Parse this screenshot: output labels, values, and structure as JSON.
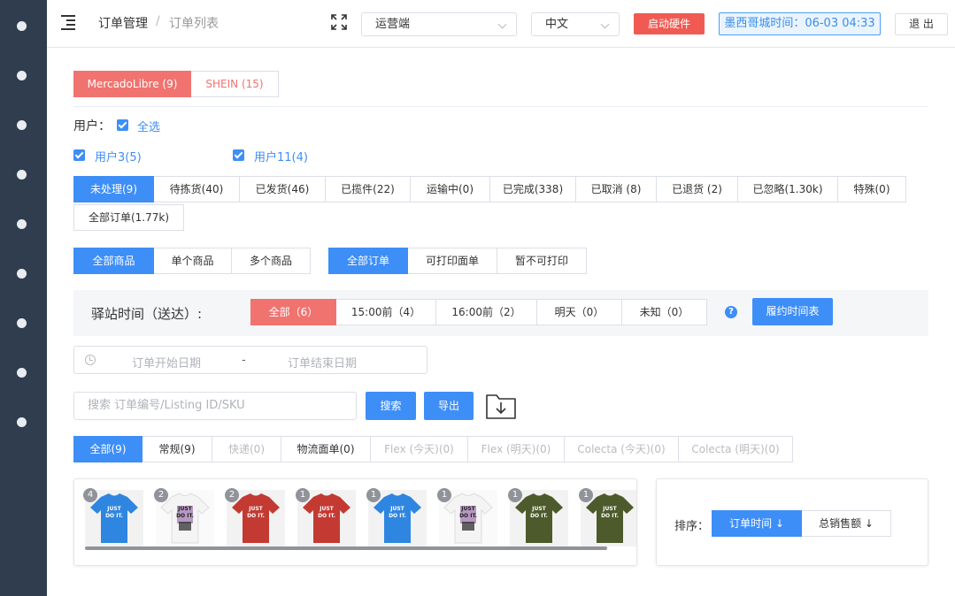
{
  "header": {
    "breadcrumb": [
      "订单管理",
      "订单列表"
    ],
    "breadcrumb_sep": "/",
    "platform_select": "运营端",
    "language_select": "中文",
    "start_hardware_label": "启动硬件",
    "time_label": "墨西哥城时间：06-03 04:33",
    "logout_label": "退 出"
  },
  "store_tabs": [
    {
      "label": "MercadoLibre (9)",
      "active": true
    },
    {
      "label": "SHEIN (15)",
      "active": false
    }
  ],
  "users": {
    "label": "用户：",
    "select_all": "全选",
    "items": [
      "用户3(5)",
      "用户11(4)"
    ]
  },
  "status_tabs": [
    "未处理(9)",
    "待拣货(40)",
    "已发货(46)",
    "已揽件(22)",
    "运输中(0)",
    "已完成(338)",
    "已取消 (8)",
    "已退货 (2)",
    "已忽略(1.30k)",
    "特殊(0)",
    "全部订单(1.77k)"
  ],
  "product_tabs": [
    "全部商品",
    "单个商品",
    "多个商品"
  ],
  "print_tabs": [
    "全部订单",
    "可打印面单",
    "暂不可打印"
  ],
  "pickup": {
    "label": "驿站时间（送达）:",
    "tabs": [
      "全部（6）",
      "15:00前（4）",
      "16:00前（2）",
      "明天（0）",
      "未知（0）"
    ],
    "help": "?",
    "schedule_button": "履约时间表"
  },
  "date_range": {
    "start_placeholder": "订单开始日期",
    "separator": "-",
    "end_placeholder": "订单结束日期"
  },
  "search": {
    "placeholder": "搜索 订单编号/Listing ID/SKU",
    "search_button": "搜索",
    "export_button": "导出"
  },
  "ship_tabs": [
    {
      "label": "全部(9)",
      "state": "active"
    },
    {
      "label": "常规(9)",
      "state": "normal"
    },
    {
      "label": "快递(0)",
      "state": "muted"
    },
    {
      "label": "物流面单(0)",
      "state": "normal"
    },
    {
      "label": "Flex (今天)(0)",
      "state": "muted"
    },
    {
      "label": "Flex (明天)(0)",
      "state": "muted"
    },
    {
      "label": "Colecta (今天)(0)",
      "state": "muted"
    },
    {
      "label": "Colecta (明天)(0)",
      "state": "muted"
    }
  ],
  "products": [
    {
      "count": "4",
      "color": "blue",
      "shirt": "#2f86e0",
      "text": "JUST DO IT."
    },
    {
      "count": "2",
      "color": "white",
      "shirt": "#f4f4f4",
      "text": "JUST DO IT."
    },
    {
      "count": "2",
      "color": "red",
      "shirt": "#c33a32",
      "text": "JUST DO IT."
    },
    {
      "count": "1",
      "color": "red",
      "shirt": "#c33a32",
      "text": "JUST DO IT."
    },
    {
      "count": "1",
      "color": "blue",
      "shirt": "#2f86e0",
      "text": "JUST DO IT."
    },
    {
      "count": "1",
      "color": "white",
      "shirt": "#f4f4f4",
      "text": "JUST DO IT."
    },
    {
      "count": "1",
      "color": "olive",
      "shirt": "#4d5a2b",
      "text": "JUST DO IT."
    },
    {
      "count": "1",
      "color": "olive",
      "shirt": "#4d5a2b",
      "text": "JUST DO IT."
    }
  ],
  "sort": {
    "label": "排序：",
    "options": [
      "订单时间 ↓",
      "总销售额 ↓"
    ]
  },
  "colors": {
    "sidebar": "#2f3d4e",
    "primary": "#3e8ef7",
    "danger": "#f0736f"
  }
}
